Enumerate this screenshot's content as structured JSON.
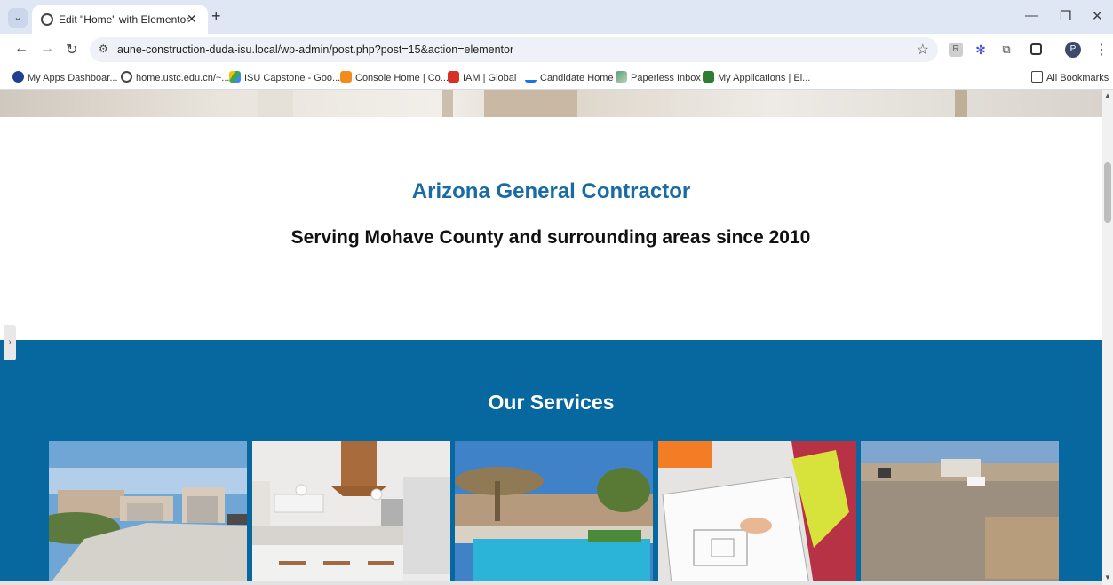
{
  "browser": {
    "tab_title": "Edit \"Home\" with Elementor",
    "url": "aune-construction-duda-isu.local/wp-admin/post.php?post=15&action=elementor",
    "profile_initial": "P",
    "bookmarks": [
      "My Apps Dashboar...",
      "home.ustc.edu.cn/~...",
      "ISU Capstone - Goo...",
      "Console Home | Co...",
      "IAM | Global",
      "Candidate Home",
      "Paperless Inbox",
      "My Applications | Ei..."
    ],
    "all_bookmarks": "All Bookmarks"
  },
  "page": {
    "about": {
      "title": "Arizona General Contractor",
      "subtitle": "Serving Mohave County and surrounding areas since 2010"
    },
    "services": {
      "title": "Our Services",
      "cards": [
        {
          "image": "house-driveway"
        },
        {
          "image": "kitchen"
        },
        {
          "image": "pool-backyard"
        },
        {
          "image": "blueprints"
        },
        {
          "image": "paver-installation"
        }
      ]
    }
  },
  "colors": {
    "accent_blue": "#1a6aa3",
    "services_bg": "#06689f"
  }
}
